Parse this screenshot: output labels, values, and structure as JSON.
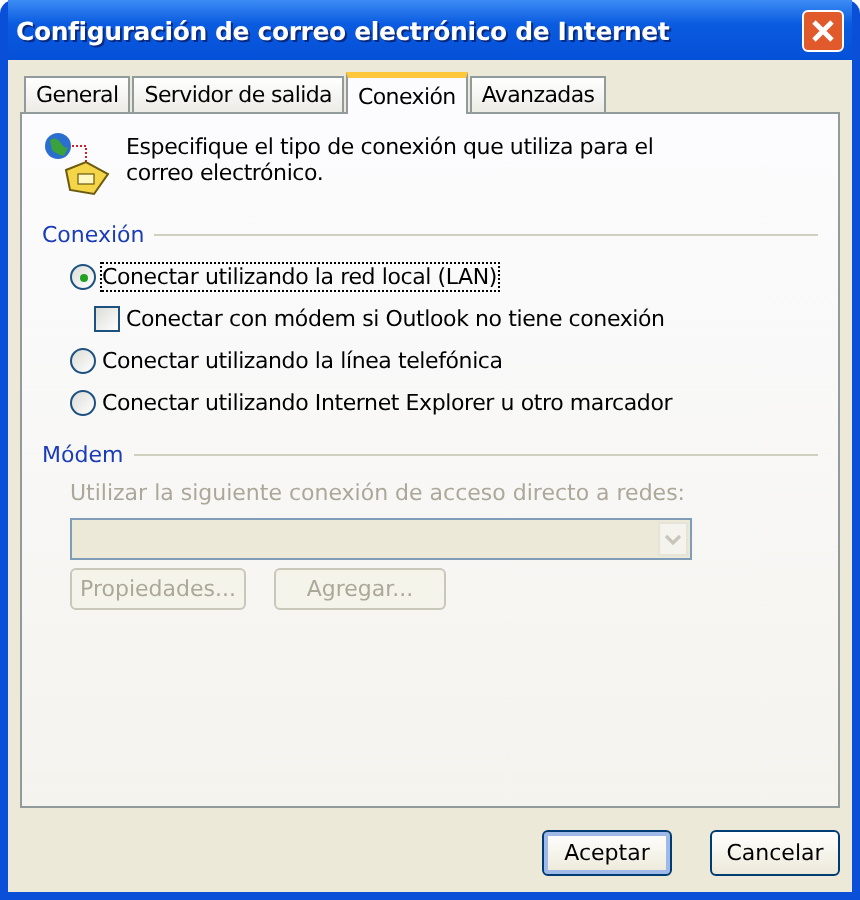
{
  "window": {
    "title": "Configuración de correo electrónico de Internet"
  },
  "tabs": [
    {
      "label": "General",
      "selected": false
    },
    {
      "label": "Servidor de salida",
      "selected": false
    },
    {
      "label": "Conexión",
      "selected": true
    },
    {
      "label": "Avanzadas",
      "selected": false
    }
  ],
  "intro": "Especifique el tipo de conexión que utiliza para el correo electrónico.",
  "connection": {
    "title": "Conexión",
    "options": [
      {
        "label": "Conectar utilizando la red local (LAN)",
        "selected": true,
        "children": [
          {
            "label": "Conectar con módem si Outlook no tiene conexión",
            "checked": false
          }
        ]
      },
      {
        "label": "Conectar utilizando la línea telefónica",
        "selected": false
      },
      {
        "label": "Conectar utilizando Internet Explorer u otro marcador",
        "selected": false
      }
    ]
  },
  "modem": {
    "title": "Módem",
    "disabled": true,
    "label": "Utilizar la siguiente conexión de acceso directo a redes:",
    "buttons": [
      "Propiedades...",
      "Agregar..."
    ]
  },
  "buttons": [
    {
      "label": "Aceptar",
      "default": true
    },
    {
      "label": "Cancelar",
      "default": false
    }
  ]
}
